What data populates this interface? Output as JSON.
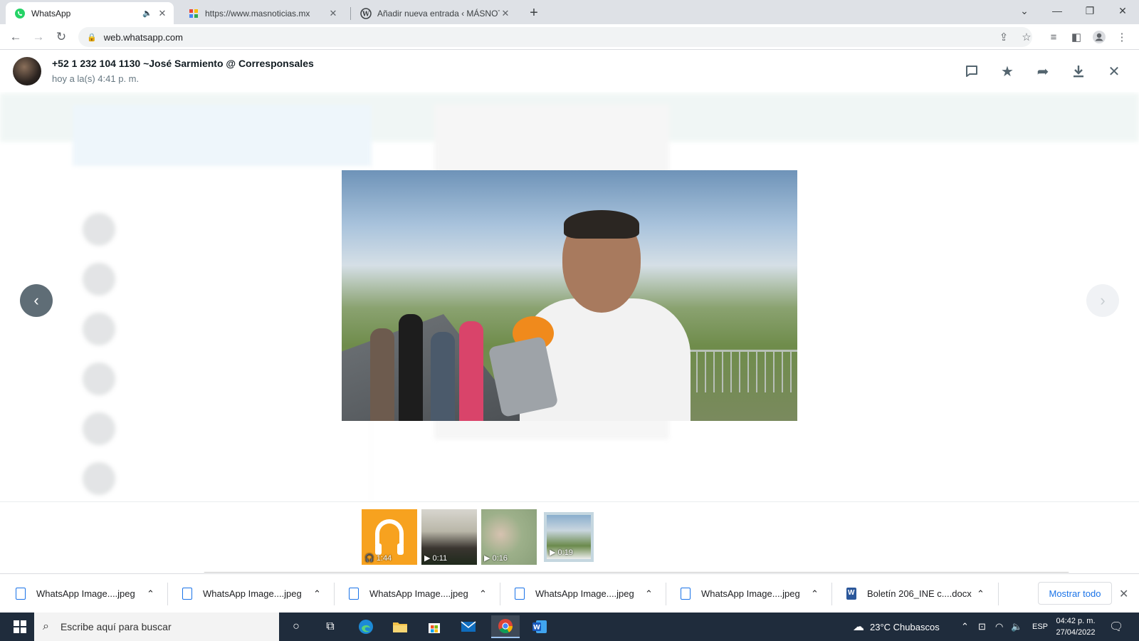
{
  "browser": {
    "tabs": [
      {
        "title": "WhatsApp",
        "active": true,
        "audio": true
      },
      {
        "title": "https://www.masnoticias.mx",
        "active": false
      },
      {
        "title": "Añadir nueva entrada ‹ MÁSNOTI",
        "active": false
      }
    ],
    "url": "web.whatsapp.com"
  },
  "viewer": {
    "sender": "+52 1 232 104 1130 ~José Sarmiento @ Corresponsales",
    "timestamp": "hoy a la(s) 4:41 p. m.",
    "thumbnails": [
      {
        "type": "audio",
        "duration": "1:44"
      },
      {
        "type": "video",
        "duration": "0:11"
      },
      {
        "type": "video",
        "duration": "0:16"
      },
      {
        "type": "video",
        "duration": "0:19",
        "selected": true
      }
    ]
  },
  "downloads": {
    "items": [
      "WhatsApp Image....jpeg",
      "WhatsApp Image....jpeg",
      "WhatsApp Image....jpeg",
      "WhatsApp Image....jpeg",
      "WhatsApp Image....jpeg",
      "Boletín 206_INE c....docx"
    ],
    "show_all": "Mostrar todo"
  },
  "taskbar": {
    "search_placeholder": "Escribe aquí para buscar",
    "weather": "23°C  Chubascos",
    "language": "ESP",
    "time": "04:42 p. m.",
    "date": "27/04/2022"
  },
  "colors": {
    "whatsapp_green": "#25d366",
    "accent_blue": "#1a73e8",
    "taskbar": "#1f2c3c"
  }
}
